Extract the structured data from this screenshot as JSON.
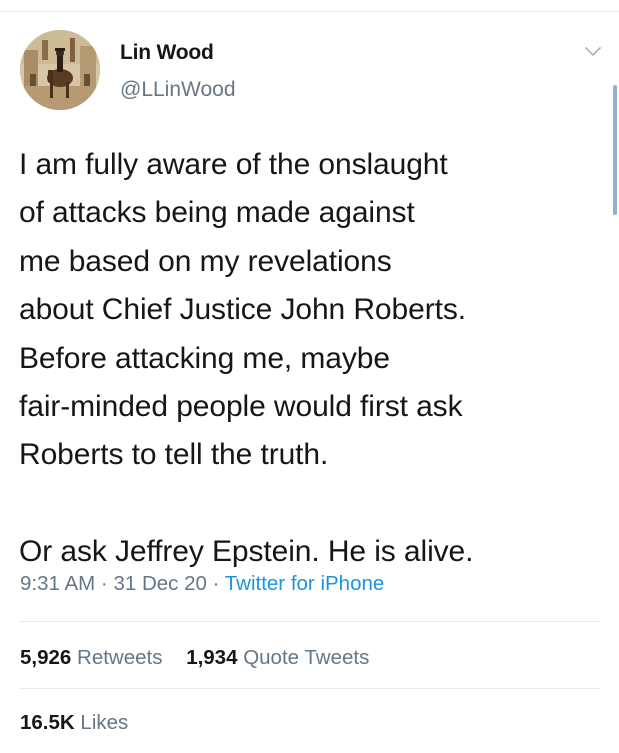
{
  "tweet": {
    "author": {
      "display_name": "Lin Wood",
      "handle": "@LLinWood"
    },
    "text": "I am fully aware of the onslaught\nof attacks being made against\nme based on my revelations\nabout Chief Justice John Roberts.\nBefore attacking me, maybe\nfair-minded people would first ask\nRoberts to tell the truth.\n\nOr ask Jeffrey Epstein. He is alive.",
    "time": "9:31 AM",
    "separator": "·",
    "date": "31 Dec 20",
    "source": "Twitter for iPhone",
    "retweets": {
      "count": "5,926",
      "label": "Retweets"
    },
    "quote_tweets": {
      "count": "1,934",
      "label": "Quote Tweets"
    },
    "likes": {
      "count": "16.5K",
      "label": "Likes"
    }
  },
  "colors": {
    "text_primary": "#14171a",
    "text_secondary": "#657786",
    "link": "#1b95e0",
    "divider": "#e6ecf0"
  },
  "icons": {
    "more_options": "chevron-down-icon"
  }
}
